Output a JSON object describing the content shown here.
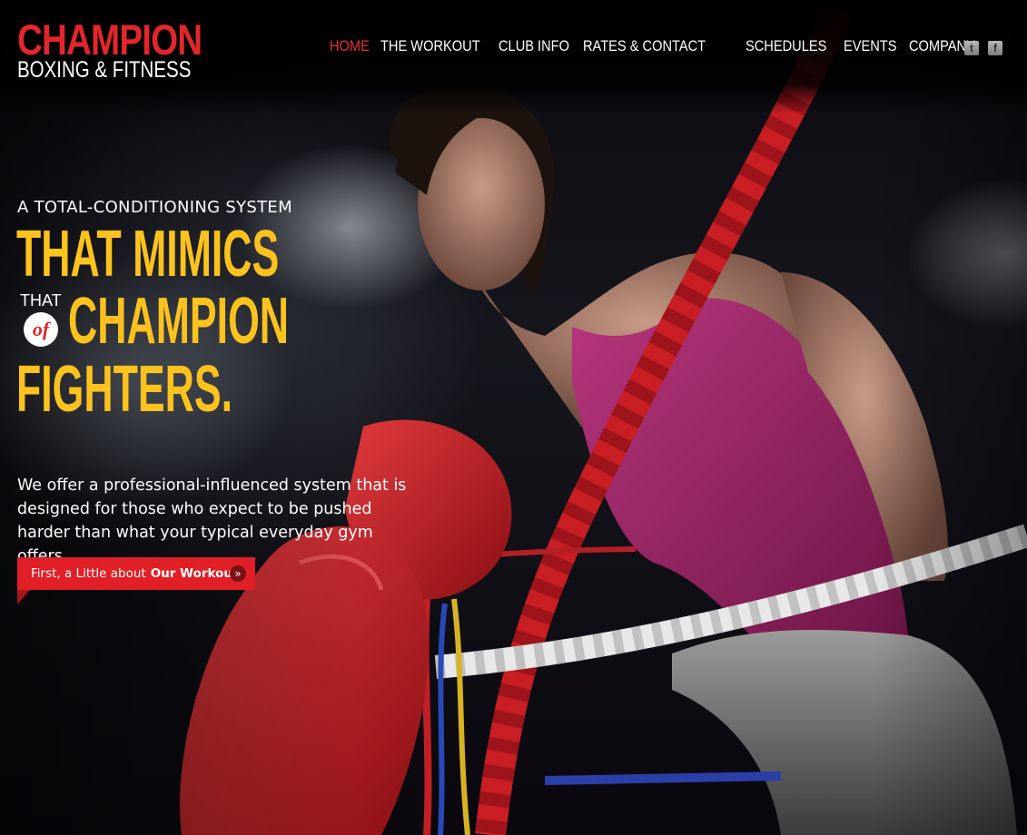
{
  "brand": {
    "title": "CHAMPION",
    "subtitle": "BOXING & FITNESS"
  },
  "nav_left": [
    {
      "label": "HOME",
      "active": true
    },
    {
      "label": "THE WORKOUT",
      "active": false
    },
    {
      "label": "CLUB INFO",
      "active": false
    },
    {
      "label": "RATES & CONTACT",
      "active": false
    }
  ],
  "nav_right": [
    {
      "label": "SCHEDULES"
    },
    {
      "label": "EVENTS"
    },
    {
      "label": "COMPANY"
    }
  ],
  "social": [
    {
      "icon": "twitter-icon",
      "glyph": "t"
    },
    {
      "icon": "facebook-icon",
      "glyph": "f"
    }
  ],
  "hero": {
    "kicker": "A TOTAL-CONDITIONING SYSTEM",
    "line1": "THAT MIMICS",
    "that_small": "THAT",
    "of_word": "of",
    "line2": "CHAMPION",
    "line3": "FIGHTERS.",
    "description": "We offer a professional-influenced system that is designed for those who expect to be pushed harder than what your typical everyday gym offers."
  },
  "cta": {
    "prefix": "First, a Little about",
    "bold": "Our Workout",
    "arrow": "»"
  },
  "colors": {
    "brand_red": "#e2262b",
    "headline_yellow": "#fcc21d",
    "nav_active": "#e8332f"
  }
}
